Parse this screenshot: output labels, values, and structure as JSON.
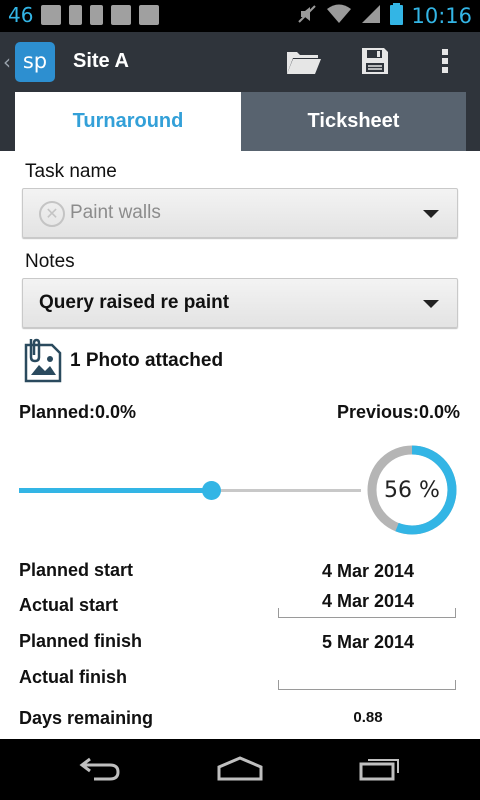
{
  "status_bar": {
    "network": "46",
    "time": "10:16"
  },
  "action_bar": {
    "logo_text": "sp",
    "title": "Site A",
    "icons": [
      "folder-icon",
      "save-icon",
      "overflow-menu-icon"
    ]
  },
  "tabs": [
    {
      "label": "Turnaround",
      "active": true
    },
    {
      "label": "Ticksheet",
      "active": false
    }
  ],
  "task": {
    "label": "Task name",
    "value": "Paint walls"
  },
  "notes": {
    "label": "Notes",
    "value": "Query raised re paint"
  },
  "attachment": {
    "text": "1 Photo attached"
  },
  "progress": {
    "planned_label": "Planned:0.0%",
    "previous_label": "Previous:0.0%",
    "value": 0.56,
    "display": "56 %"
  },
  "schedule": {
    "planned_start_label": "Planned start",
    "planned_start_value": "4 Mar 2014",
    "actual_start_label": "Actual start",
    "actual_start_value": "4 Mar 2014",
    "planned_finish_label": "Planned finish",
    "planned_finish_value": "5 Mar 2014",
    "actual_finish_label": "Actual finish",
    "actual_finish_value": "",
    "days_remaining_label": "Days remaining",
    "days_remaining_value": "0.88"
  },
  "colors": {
    "accent": "#33b5e5",
    "tab_active_text": "#33a0d8",
    "action_bar": "#2f343b"
  }
}
